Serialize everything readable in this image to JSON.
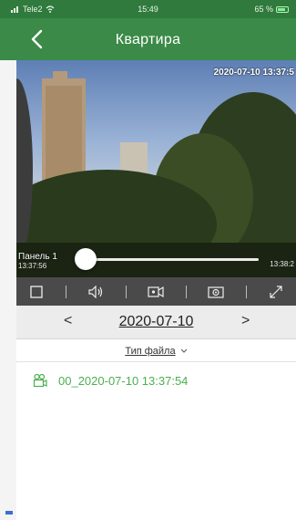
{
  "status": {
    "carrier": "Tele2",
    "time": "15:49",
    "battery": "65 %"
  },
  "nav": {
    "title": "Квартира"
  },
  "video": {
    "timestamp": "2020-07-10 13:37:5",
    "camera_label": "Панель 1",
    "start_time": "13:37:56",
    "end_time": "13:38:2",
    "progress": 0.05
  },
  "controls": {
    "icons": [
      "stop-icon",
      "speaker-icon",
      "record-video-icon",
      "snapshot-icon",
      "fullscreen-icon"
    ]
  },
  "date_nav": {
    "prev": "<",
    "date": "2020-07-10",
    "next": ">"
  },
  "filter": {
    "label": "Тип файла"
  },
  "records": [
    {
      "name": "00_2020-07-10 13:37:54",
      "color": "#4caf50"
    }
  ],
  "colors": {
    "navbar": "#3b8a47",
    "accent": "#4caf50"
  }
}
